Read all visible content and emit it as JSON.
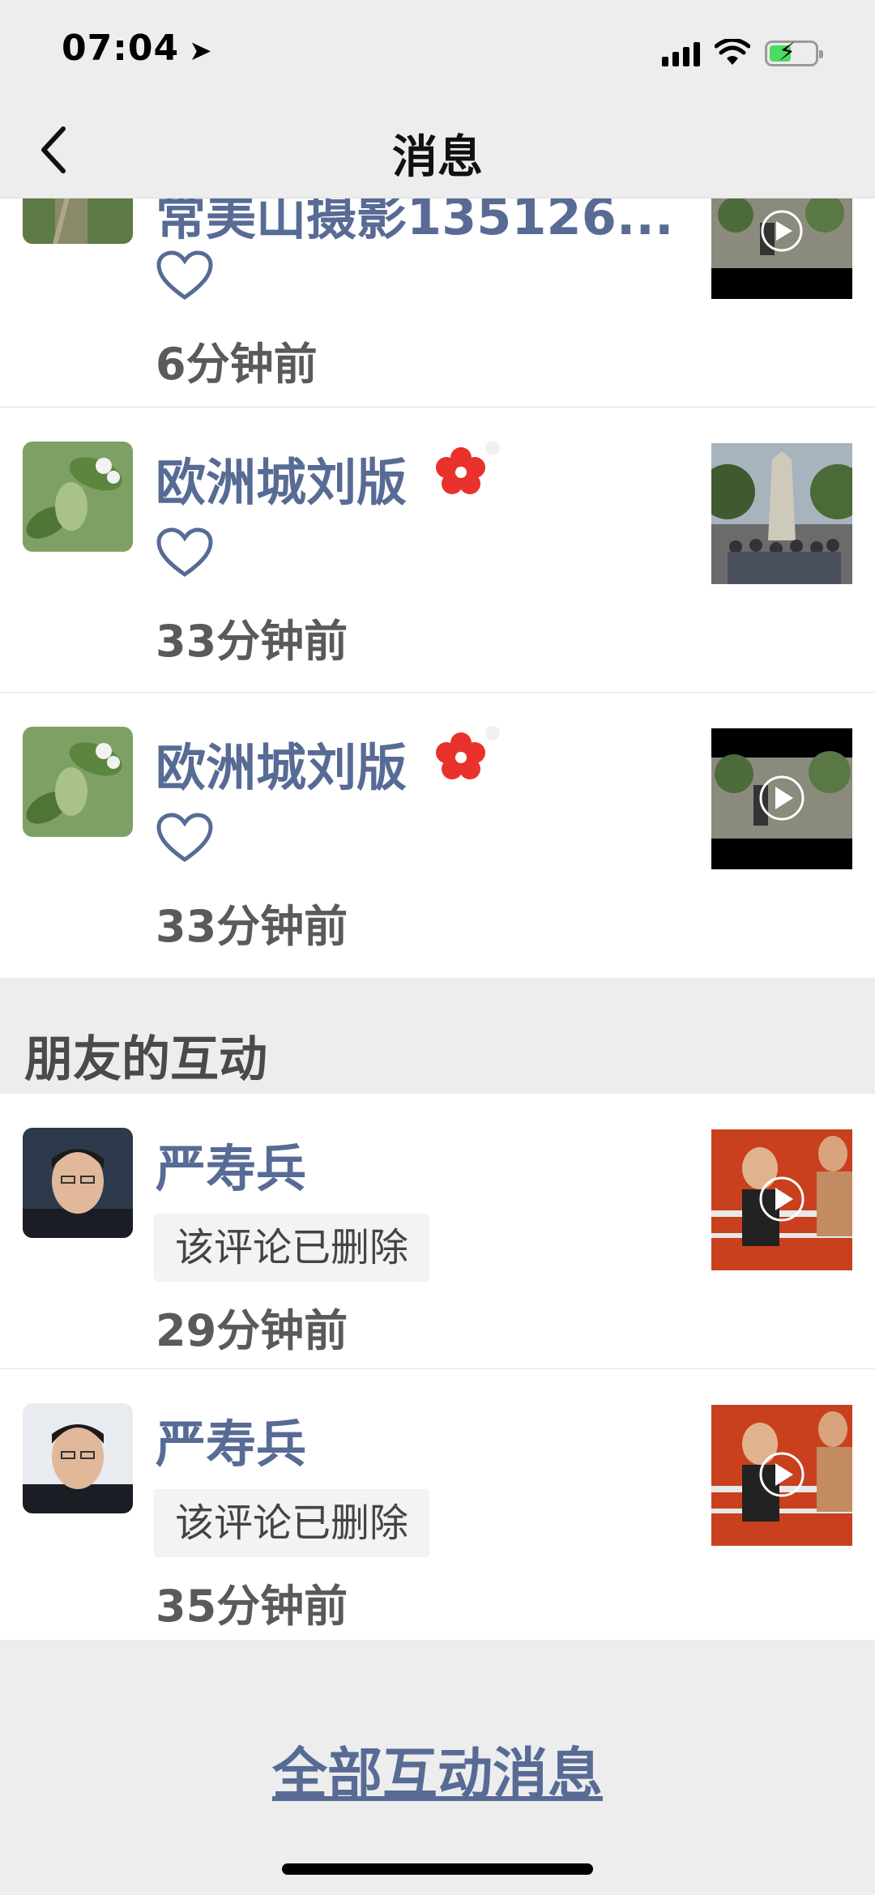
{
  "status_bar": {
    "time": "07:04",
    "location_icon": "location-arrow-icon",
    "battery_color": "#4cd964"
  },
  "nav": {
    "title": "消息",
    "back_icon": "chevron-left-icon"
  },
  "top_items": [
    {
      "name": "常美山摄影135126...",
      "time": "6分钟前",
      "liked": true
    },
    {
      "name": "欧洲城刘版",
      "time": "33分钟前",
      "liked": true
    },
    {
      "name": "欧洲城刘版",
      "time": "33分钟前",
      "liked": true
    }
  ],
  "friends_section": {
    "title": "朋友的互动",
    "items": [
      {
        "name": "严寿兵",
        "comment": "该评论已删除",
        "time": "29分钟前"
      },
      {
        "name": "严寿兵",
        "comment": "该评论已删除",
        "time": "35分钟前"
      }
    ]
  },
  "footer": {
    "all_link": "全部互动消息"
  },
  "colors": {
    "name_blue": "#576b95",
    "bg": "#ededed",
    "heart_stroke": "#576b95"
  }
}
